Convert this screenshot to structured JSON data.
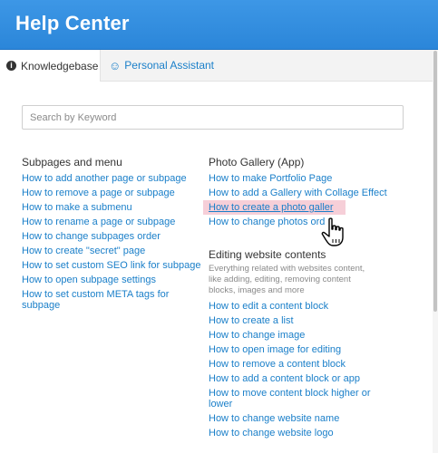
{
  "header": {
    "title": "Help Center",
    "color": "#3590e0"
  },
  "tabs": [
    {
      "label": "Knowledgebase",
      "icon": "info-icon",
      "active": true
    },
    {
      "label": "Personal Assistant",
      "icon": "smiley-icon",
      "active": false
    }
  ],
  "search": {
    "placeholder": "Search by Keyword",
    "value": ""
  },
  "sections": {
    "subpages": {
      "title": "Subpages and menu",
      "links": [
        "How to add another page or subpage",
        "How to remove a page or subpage",
        "How to make a submenu",
        "How to rename a page or subpage",
        "How to change subpages order",
        "How to create \"secret\" page",
        "How to set custom SEO link for subpage",
        "How to open subpage settings",
        "How to set custom META tags for subpage"
      ]
    },
    "photo_gallery": {
      "title": "Photo Gallery (App)",
      "links": [
        "How to make Portfolio Page",
        "How to add a Gallery with Collage Effect",
        "How to create a photo galler",
        "How to change photos ord"
      ],
      "highlighted_index": 2
    },
    "editing": {
      "title": "Editing website contents",
      "description": "Everything related with websites content, like adding, editing, removing content blocks, images and more",
      "links": [
        "How to edit a content block",
        "How to create a list",
        "How to change image",
        "How to open image for editing",
        "How to remove a content block",
        "How to add a content block or app",
        "How to move content block higher or lower",
        "How to change website name",
        "How to change website logo"
      ]
    }
  },
  "colors": {
    "link": "#1a7fc9",
    "highlight": "#f6cfd8"
  }
}
